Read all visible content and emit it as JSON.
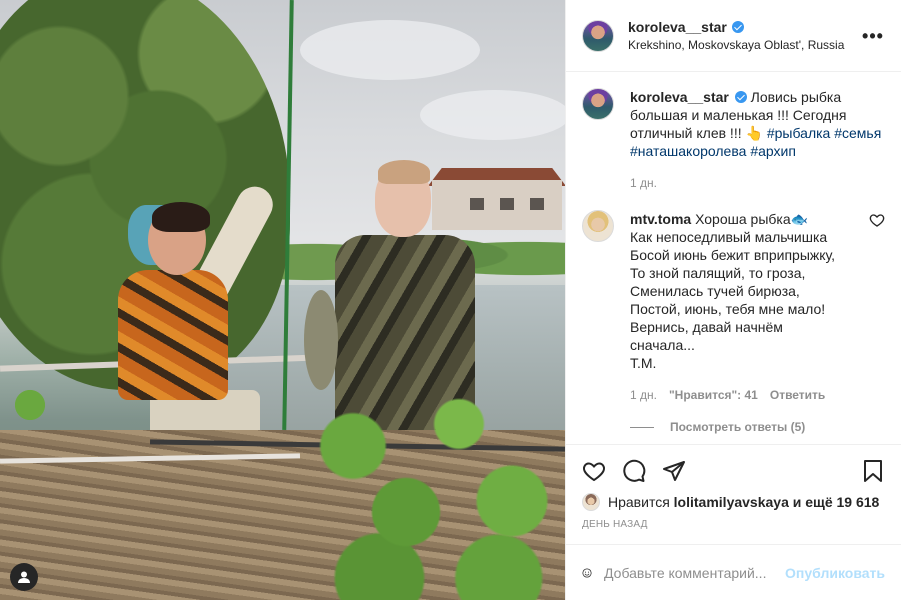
{
  "post": {
    "author": {
      "username": "koroleva__star",
      "verified": true,
      "location": "Krekshino, Moskovskaya Oblast', Russia"
    },
    "caption": {
      "username": "koroleva__star",
      "text": "Ловись рыбка большая и маленькая !!! Сегодня отличный клев !!! 👆",
      "hashtags": [
        "#рыбалка",
        "#семья",
        "#наташакоролева",
        "#архип"
      ],
      "time": "1 дн."
    },
    "comments": [
      {
        "username": "mtv.toma",
        "text": "Хороша рыбка🐟\nКак непоседливый мальчишка\nБосой июнь бежит вприпрыжку,\nТо зной палящий, то гроза,\nСменилась тучей бирюза,\nПостой, июнь, тебя мне мало!\nВернись, давай начнём\nсначала...\nТ.М.",
        "time": "1 дн.",
        "likes_label": "\"Нравится\": 41",
        "reply_label": "Ответить",
        "view_replies": "Посмотреть ответы (5)"
      }
    ],
    "likes": {
      "prefix": "Нравится",
      "user": "lolitamilyavskaya",
      "suffix": "и ещё 19 618"
    },
    "posted": "ДЕНЬ НАЗАД",
    "add_comment": {
      "placeholder": "Добавьте комментарий...",
      "post_label": "Опубликовать"
    }
  },
  "icons": {
    "more": "more-options-icon",
    "heart": "heart-icon",
    "comment": "comment-icon",
    "share": "share-icon",
    "save": "bookmark-icon",
    "emoji": "emoji-icon",
    "tag": "user-tag-icon"
  },
  "colors": {
    "link": "#00376b",
    "verified": "#3897f0",
    "muted": "#8e8e8e",
    "post_btn": "#b2dffc"
  }
}
